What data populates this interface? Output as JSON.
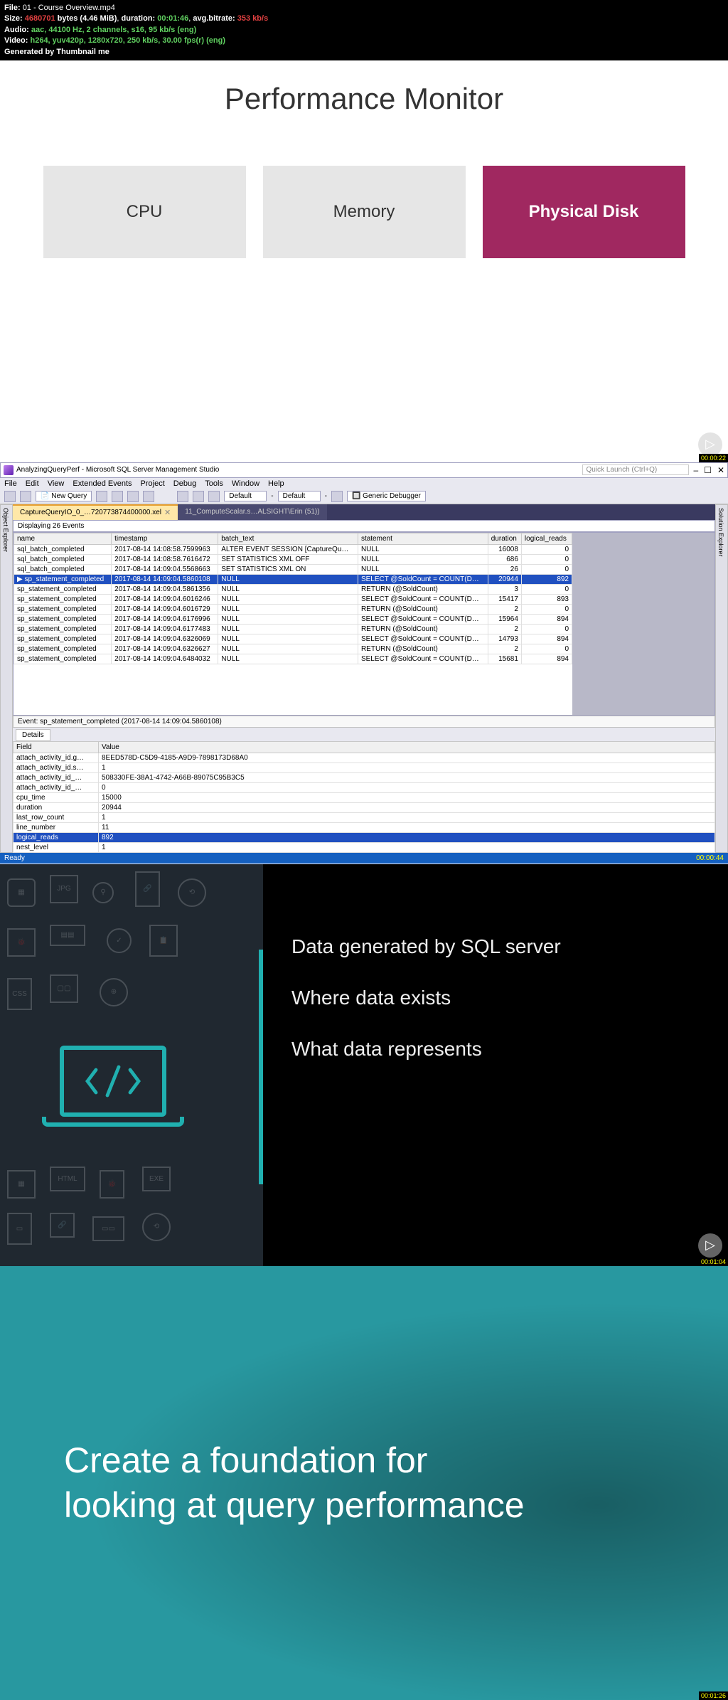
{
  "meta": {
    "file_label": "File:",
    "file_value": "01 - Course Overview.mp4",
    "size_label": "Size:",
    "size_bytes": "4680701",
    "size_unit": "bytes (4.46 MiB)",
    "duration_label": "duration:",
    "duration_value": "00:01:46",
    "bitrate_label": "avg.bitrate:",
    "bitrate_value": "353 kb/s",
    "audio_label": "Audio:",
    "audio_value": "aac, 44100 Hz, 2 channels, s16, 95 kb/s (eng)",
    "video_label": "Video:",
    "video_value": "h264, yuv420p, 1280x720, 250 kb/s, 30.00 fps(r) (eng)",
    "generated": "Generated by Thumbnail me"
  },
  "slide1": {
    "title": "Performance Monitor",
    "card_cpu": "CPU",
    "card_memory": "Memory",
    "card_disk": "Physical Disk",
    "ts": "00:00:22"
  },
  "ssms": {
    "window_title": "AnalyzingQueryPerf - Microsoft SQL Server Management Studio",
    "quick_launch": "Quick Launch (Ctrl+Q)",
    "menu": [
      "File",
      "Edit",
      "View",
      "Extended Events",
      "Project",
      "Debug",
      "Tools",
      "Window",
      "Help"
    ],
    "new_query": "New Query",
    "default1": "Default",
    "default2": "Default",
    "debugger": "Generic Debugger",
    "tab_active": "CaptureQueryIO_0_…720773874400000.xel",
    "tab_inactive": "11_ComputeScalar.s…ALSIGHT\\Erin (51))",
    "displaying": "Displaying 26 Events",
    "side_left": "Object Explorer",
    "side_right": "Solution Explorer",
    "cols": [
      "name",
      "timestamp",
      "batch_text",
      "statement",
      "duration",
      "logical_reads"
    ],
    "rows": [
      {
        "n": "sql_batch_completed",
        "t": "2017-08-14 14:08:58.7599963",
        "b": "ALTER EVENT SESSION [CaptureQu…",
        "s": "NULL",
        "d": "16008",
        "r": "0"
      },
      {
        "n": "sql_batch_completed",
        "t": "2017-08-14 14:08:58.7616472",
        "b": "SET STATISTICS XML OFF",
        "s": "NULL",
        "d": "686",
        "r": "0"
      },
      {
        "n": "sql_batch_completed",
        "t": "2017-08-14 14:09:04.5568663",
        "b": "SET STATISTICS XML ON",
        "s": "NULL",
        "d": "26",
        "r": "0"
      },
      {
        "n": "sp_statement_completed",
        "t": "2017-08-14 14:09:04.5860108",
        "b": "NULL",
        "s": "SELECT @SoldCount = COUNT(D…",
        "d": "20944",
        "r": "892",
        "sel": true
      },
      {
        "n": "sp_statement_completed",
        "t": "2017-08-14 14:09:04.5861356",
        "b": "NULL",
        "s": "RETURN (@SoldCount)",
        "d": "3",
        "r": "0"
      },
      {
        "n": "sp_statement_completed",
        "t": "2017-08-14 14:09:04.6016246",
        "b": "NULL",
        "s": "SELECT @SoldCount = COUNT(D…",
        "d": "15417",
        "r": "893"
      },
      {
        "n": "sp_statement_completed",
        "t": "2017-08-14 14:09:04.6016729",
        "b": "NULL",
        "s": "RETURN (@SoldCount)",
        "d": "2",
        "r": "0"
      },
      {
        "n": "sp_statement_completed",
        "t": "2017-08-14 14:09:04.6176996",
        "b": "NULL",
        "s": "SELECT @SoldCount = COUNT(D…",
        "d": "15964",
        "r": "894"
      },
      {
        "n": "sp_statement_completed",
        "t": "2017-08-14 14:09:04.6177483",
        "b": "NULL",
        "s": "RETURN (@SoldCount)",
        "d": "2",
        "r": "0"
      },
      {
        "n": "sp_statement_completed",
        "t": "2017-08-14 14:09:04.6326069",
        "b": "NULL",
        "s": "SELECT @SoldCount = COUNT(D…",
        "d": "14793",
        "r": "894"
      },
      {
        "n": "sp_statement_completed",
        "t": "2017-08-14 14:09:04.6326627",
        "b": "NULL",
        "s": "RETURN (@SoldCount)",
        "d": "2",
        "r": "0"
      },
      {
        "n": "sp_statement_completed",
        "t": "2017-08-14 14:09:04.6484032",
        "b": "NULL",
        "s": "SELECT @SoldCount = COUNT(D…",
        "d": "15681",
        "r": "894"
      }
    ],
    "event_footer": "Event: sp_statement_completed (2017-08-14 14:09:04.5860108)",
    "details_label": "Details",
    "details_cols": [
      "Field",
      "Value"
    ],
    "details": [
      {
        "f": "attach_activity_id.g…",
        "v": "8EED578D-C5D9-4185-A9D9-7898173D68A0"
      },
      {
        "f": "attach_activity_id.s…",
        "v": "1"
      },
      {
        "f": "attach_activity_id_…",
        "v": "508330FE-38A1-4742-A66B-89075C95B3C5"
      },
      {
        "f": "attach_activity_id_…",
        "v": "0"
      },
      {
        "f": "cpu_time",
        "v": "15000"
      },
      {
        "f": "duration",
        "v": "20944"
      },
      {
        "f": "last_row_count",
        "v": "1"
      },
      {
        "f": "line_number",
        "v": "11"
      },
      {
        "f": "logical_reads",
        "v": "892",
        "sel": true
      },
      {
        "f": "nest_level",
        "v": "1"
      }
    ],
    "status_ready": "Ready",
    "ts": "00:00:44"
  },
  "slide3": {
    "line1": "Data generated by SQL server",
    "line2": "Where data exists",
    "line3": "What data represents",
    "ts": "00:01:04"
  },
  "slide4": {
    "text": "Create a foundation for looking at query performance",
    "ts": "00:01:26"
  }
}
